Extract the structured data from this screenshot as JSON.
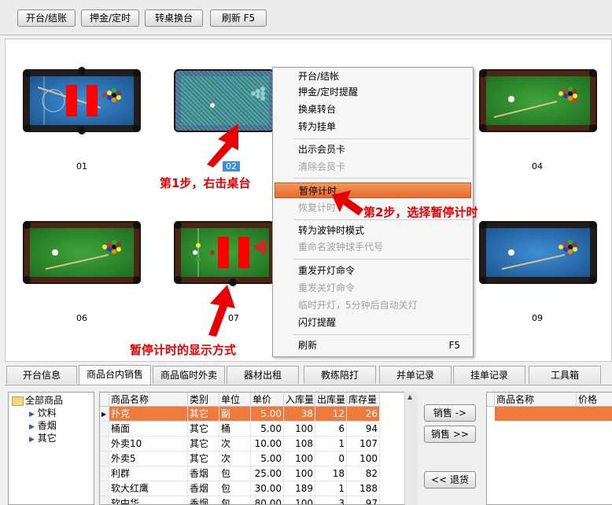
{
  "toolbar": {
    "open_close": "开台/结账",
    "deposit": "押金/定时",
    "swap": "转桌换台",
    "refresh": "刷新 F5"
  },
  "tables": [
    {
      "label": "01",
      "style": "blue",
      "paused": true
    },
    {
      "label": "02",
      "style": "selected",
      "paused": false
    },
    {
      "label": "04",
      "style": "green",
      "paused": false
    },
    {
      "label": "06",
      "style": "green",
      "paused": false
    },
    {
      "label": "07",
      "style": "snooker",
      "paused": true
    },
    {
      "label": "09",
      "style": "blue",
      "paused": false
    }
  ],
  "context_menu": [
    {
      "label": "开台/结帐",
      "disabled": false
    },
    {
      "label": "押金/定时提醒",
      "disabled": false
    },
    {
      "label": "换桌转台",
      "disabled": false
    },
    {
      "label": "转为挂单",
      "disabled": false
    },
    {
      "label": "出示会员卡",
      "disabled": false
    },
    {
      "label": "清除会员卡",
      "disabled": true
    },
    {
      "label": "暂停计时",
      "disabled": false,
      "highlighted": true
    },
    {
      "label": "恢复计时",
      "disabled": true
    },
    {
      "label": "转为波钟时模式",
      "disabled": false
    },
    {
      "label": "重命名波钟球手代号",
      "disabled": true
    },
    {
      "label": "重发开灯命令",
      "disabled": false
    },
    {
      "label": "重发关灯命令",
      "disabled": true
    },
    {
      "label": "临时开灯，5分钟后自动关灯",
      "disabled": true
    },
    {
      "label": "闪灯提醒",
      "disabled": false
    },
    {
      "label": "刷新",
      "disabled": false,
      "shortcut": "F5"
    }
  ],
  "annotations": {
    "step1": "第1步，右击桌台",
    "step2": "第2步，选择暂停计时",
    "paused_display": "暂停计时的显示方式"
  },
  "tabs": [
    "开台信息",
    "商品台内销售",
    "商品临时外卖",
    "器材出租",
    "教练陪打",
    "并单记录",
    "挂单记录",
    "工具箱"
  ],
  "active_tab": 1,
  "tree": {
    "root": "全部商品",
    "children": [
      "饮料",
      "香烟",
      "其它"
    ]
  },
  "grid": {
    "headers": [
      "商品名称",
      "类别",
      "单位",
      "单价",
      "入库量",
      "出库量",
      "库存量"
    ],
    "rows": [
      [
        "扑克",
        "其它",
        "副",
        "5.00",
        "38",
        "12",
        "26"
      ],
      [
        "桶面",
        "其它",
        "桶",
        "5.00",
        "100",
        "6",
        "94"
      ],
      [
        "外卖10",
        "其它",
        "次",
        "10.00",
        "108",
        "1",
        "107"
      ],
      [
        "外卖5",
        "其它",
        "次",
        "5.00",
        "100",
        "0",
        "100"
      ],
      [
        "利群",
        "香烟",
        "包",
        "25.00",
        "100",
        "18",
        "82"
      ],
      [
        "软大红鹰",
        "香烟",
        "包",
        "30.00",
        "189",
        "1",
        "188"
      ],
      [
        "软中华",
        "香烟",
        "包",
        "80.00",
        "100",
        "3",
        "97"
      ]
    ]
  },
  "side_buttons": {
    "sell_one": "销售 ->",
    "sell_all": "销售 >>",
    "return": "<< 退货"
  },
  "right_grid": {
    "headers": [
      "商品名称",
      "价格"
    ]
  }
}
